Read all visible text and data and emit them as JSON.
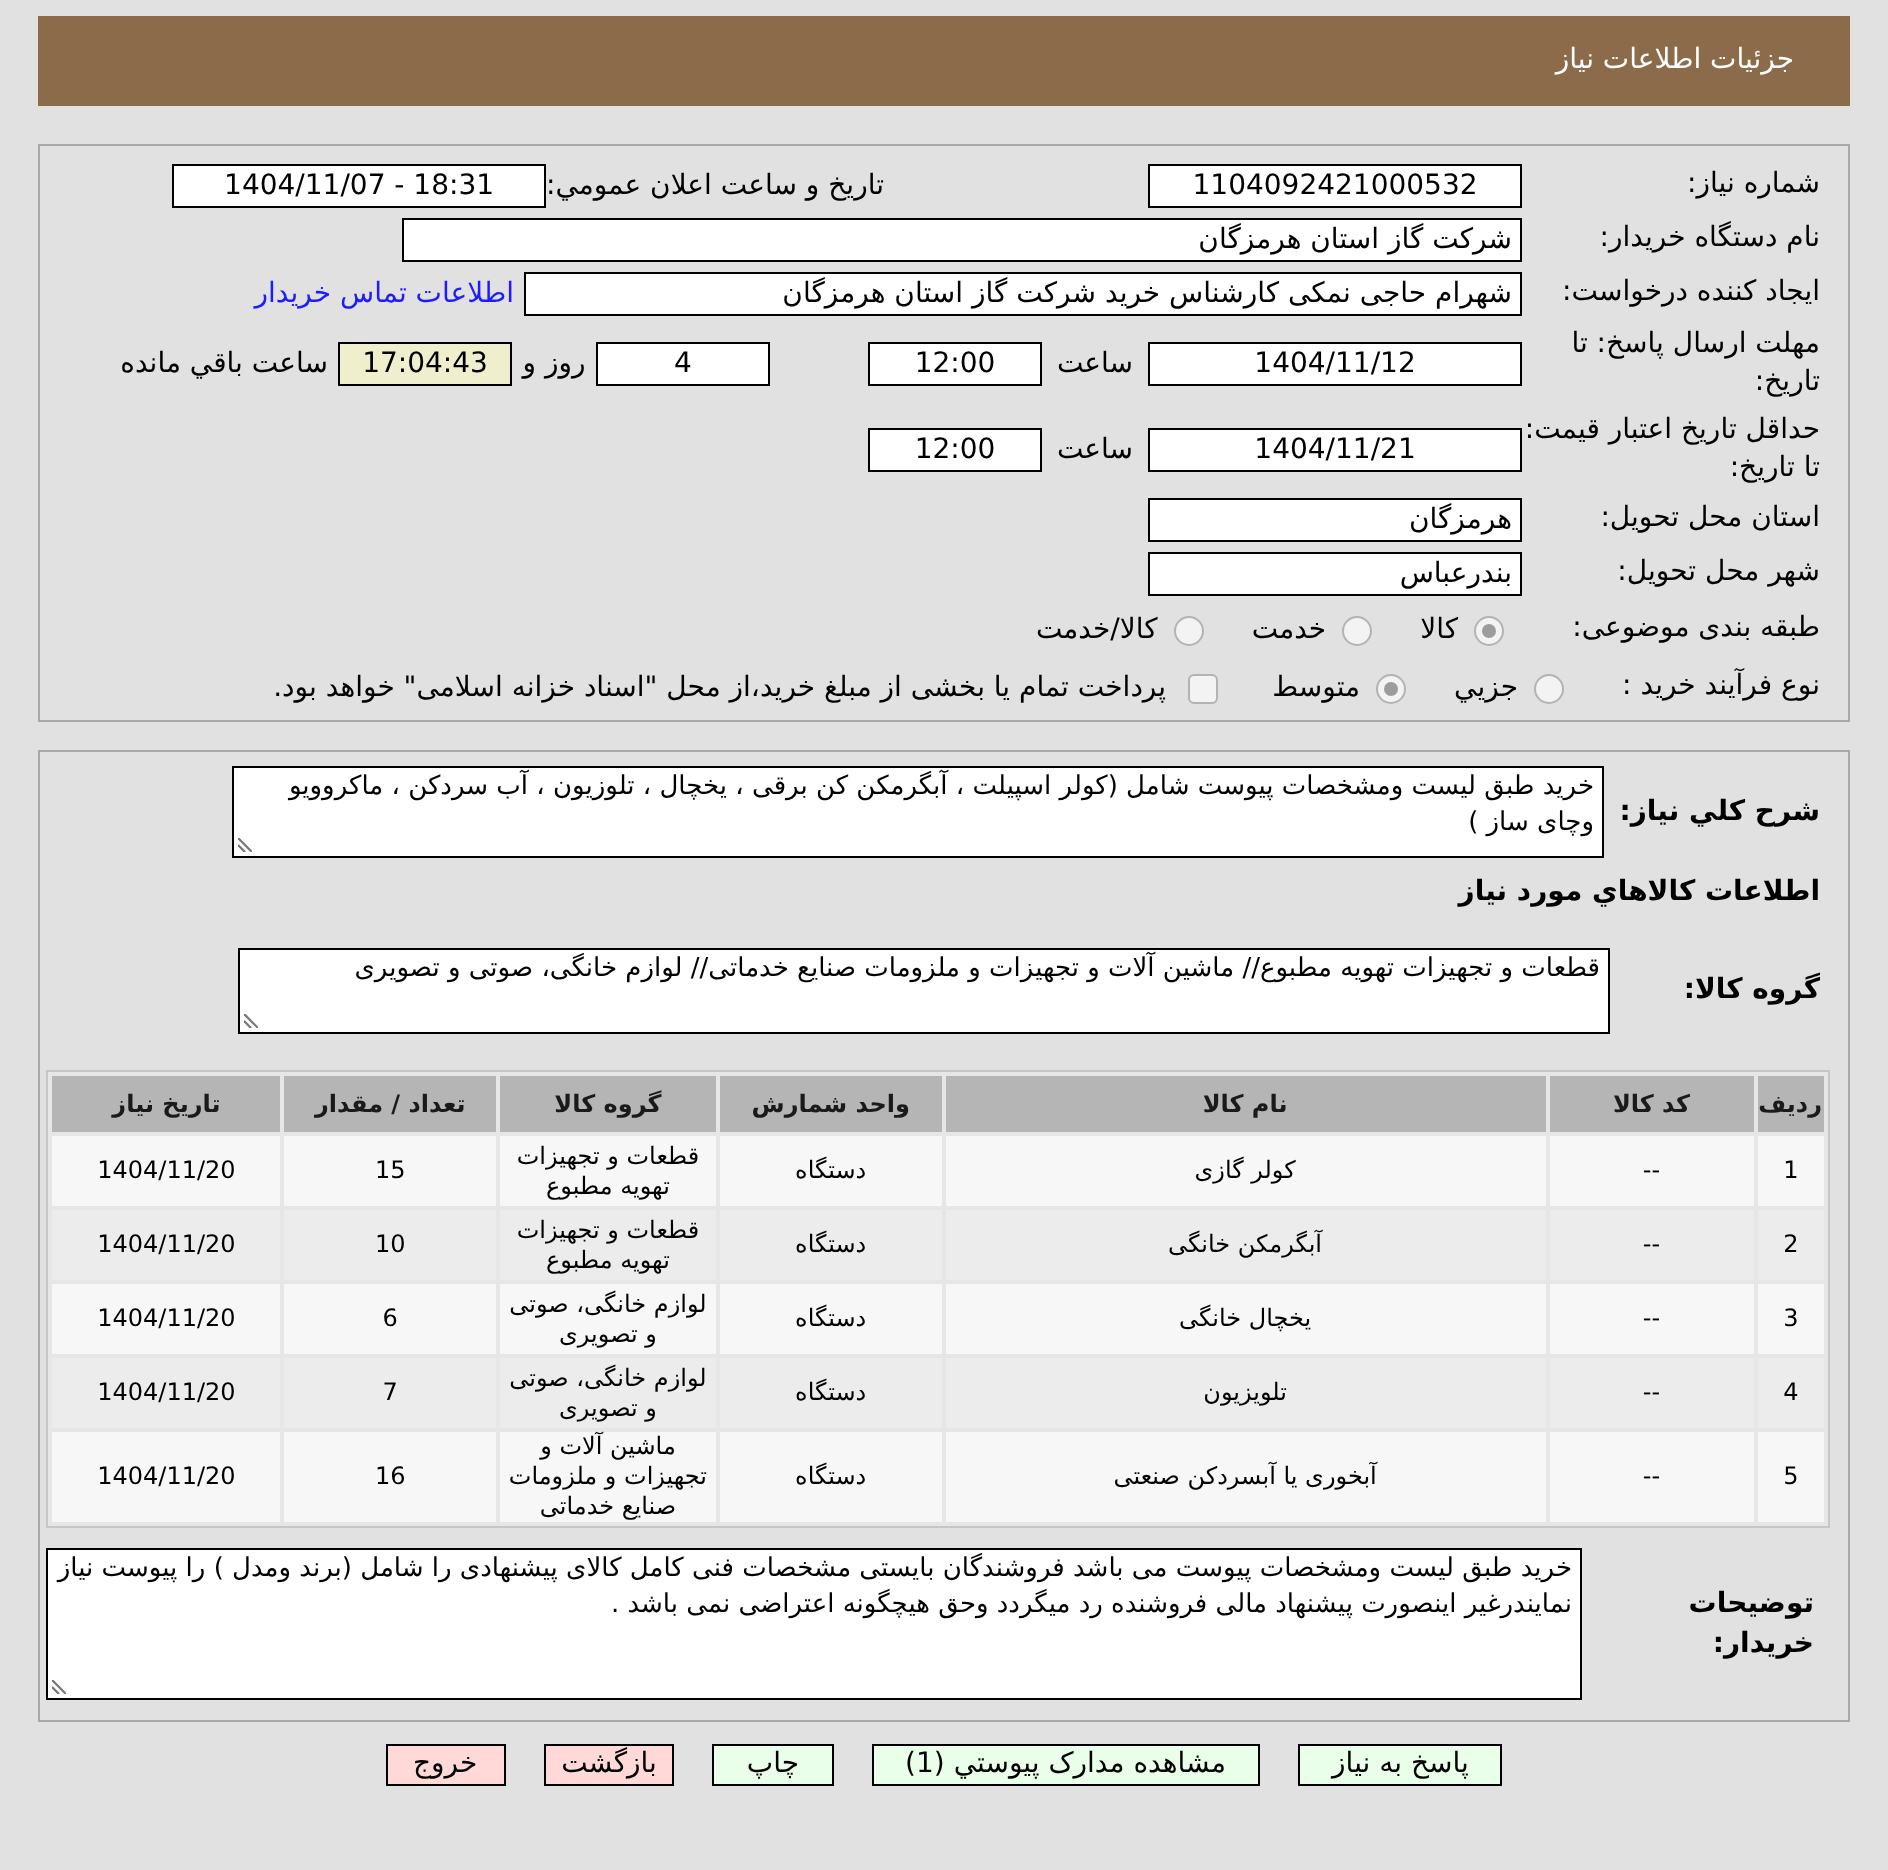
{
  "header": {
    "title": "جزئیات اطلاعات نیاز"
  },
  "details": {
    "need_number": {
      "label": "شماره نیاز:",
      "value": "1104092421000532"
    },
    "announcement": {
      "label": "تاریخ و ساعت اعلان عمومي:",
      "value": "1404/11/07 - 18:31"
    },
    "buyer_org": {
      "label": "نام دستگاه خریدار:",
      "value": "شرکت گاز استان هرمزگان"
    },
    "requester": {
      "label": "ایجاد کننده درخواست:",
      "value": "شهرام حاجی نمکی کارشناس خرید شرکت گاز استان هرمزگان",
      "contact_link": "اطلاعات تماس خریدار"
    },
    "reply_deadline": {
      "label": "مهلت ارسال پاسخ: تا تاریخ:",
      "date": "1404/11/12",
      "time_label": "ساعت",
      "time": "12:00",
      "days": "4",
      "days_label": "روز و",
      "remaining": "17:04:43",
      "remaining_label": "ساعت باقي مانده"
    },
    "price_validity": {
      "label": "حداقل تاریخ اعتبار قیمت: تا تاریخ:",
      "date": "1404/11/21",
      "time_label": "ساعت",
      "time": "12:00"
    },
    "delivery_province": {
      "label": "استان محل تحویل:",
      "value": "هرمزگان"
    },
    "delivery_city": {
      "label": "شهر محل تحویل:",
      "value": "بندرعباس"
    },
    "category": {
      "label": "طبقه بندی موضوعی:",
      "options": [
        {
          "label": "کالا",
          "selected": true
        },
        {
          "label": "خدمت",
          "selected": false
        },
        {
          "label": "کالا/خدمت",
          "selected": false
        }
      ]
    },
    "process_type": {
      "label": "نوع فرآیند خرید :",
      "options": [
        {
          "label": "جزيي",
          "selected": false
        },
        {
          "label": "متوسط",
          "selected": true
        }
      ],
      "treasury_option": {
        "label": "پرداخت تمام یا بخشی از مبلغ خرید،از محل \"اسناد خزانه اسلامی\" خواهد بود.",
        "checked": false
      }
    }
  },
  "need": {
    "description": {
      "label": "شرح کلي نیاز:",
      "value": "خرید طبق لیست ومشخصات پیوست شامل (کولر اسپیلت ، آبگرمکن کن برقی ، یخچال ، تلوزیون ، آب سردکن ، ماکروویو وچای ساز )"
    },
    "goods_heading": "اطلاعات کالاهاي مورد نیاز",
    "goods_group": {
      "label": "گروه کالا:",
      "value": "قطعات و تجهیزات تهویه مطبوع// ماشین آلات و تجهیزات و ملزومات صنایع خدماتی// لوازم خانگی، صوتی و تصویری"
    },
    "goods_table": {
      "columns": [
        "ردیف",
        "کد کالا",
        "نام کالا",
        "واحد شمارش",
        "گروه کالا",
        "تعداد / مقدار",
        "تاریخ نیاز"
      ],
      "rows": [
        [
          "1",
          "--",
          "کولر گازی",
          "دستگاه",
          "قطعات و تجهیزات تهویه مطبوع",
          "15",
          "1404/11/20"
        ],
        [
          "2",
          "--",
          "آبگرمکن خانگی",
          "دستگاه",
          "قطعات و تجهیزات تهویه مطبوع",
          "10",
          "1404/11/20"
        ],
        [
          "3",
          "--",
          "یخچال خانگی",
          "دستگاه",
          "لوازم خانگی، صوتی و تصویری",
          "6",
          "1404/11/20"
        ],
        [
          "4",
          "--",
          "تلویزیون",
          "دستگاه",
          "لوازم خانگی، صوتی و تصویری",
          "7",
          "1404/11/20"
        ],
        [
          "5",
          "--",
          "آبخوری یا آبسردکن صنعتی",
          "دستگاه",
          "ماشین آلات و تجهیزات و ملزومات صنایع خدماتی",
          "16",
          "1404/11/20"
        ]
      ]
    },
    "buyer_notes": {
      "label": "توضیحات خریدار:",
      "value": "خرید طبق لیست ومشخصات پیوست می باشد فروشندگان بایستی مشخصات فنی کامل کالای پیشنهادی را شامل (برند ومدل ) را پیوست نیاز نمایندرغیر اینصورت پیشنهاد مالی فروشنده رد میگردد وحق هیچگونه اعتراضی نمی باشد ."
    }
  },
  "buttons": [
    {
      "label": "پاسخ به نیاز",
      "kind": "normal"
    },
    {
      "label": "مشاهده مدارک پیوستي (1)",
      "kind": "normal"
    },
    {
      "label": "چاپ",
      "kind": "normal"
    },
    {
      "label": "بازگشت",
      "kind": "leave"
    },
    {
      "label": "خروج",
      "kind": "leave"
    }
  ]
}
